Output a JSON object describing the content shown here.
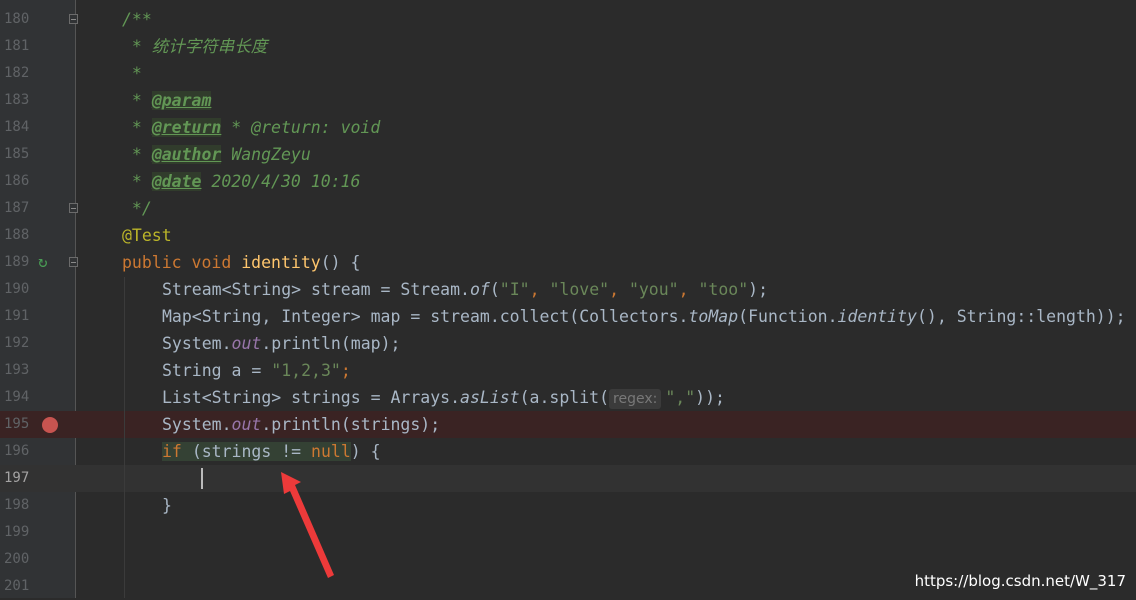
{
  "editor": {
    "lines": [
      {
        "number": "180"
      },
      {
        "number": "181"
      },
      {
        "number": "182"
      },
      {
        "number": "183"
      },
      {
        "number": "184"
      },
      {
        "number": "185"
      },
      {
        "number": "186"
      },
      {
        "number": "187"
      },
      {
        "number": "188"
      },
      {
        "number": "189"
      },
      {
        "number": "190"
      },
      {
        "number": "191"
      },
      {
        "number": "192"
      },
      {
        "number": "193"
      },
      {
        "number": "194"
      },
      {
        "number": "195"
      },
      {
        "number": "196"
      },
      {
        "number": "197"
      },
      {
        "number": "198"
      },
      {
        "number": "199"
      },
      {
        "number": "200"
      },
      {
        "number": "201"
      }
    ],
    "code": {
      "l180": "/**",
      "l181": " * 统计字符串长度",
      "l182": " *",
      "l183_star": " * ",
      "l183_tag": "@param",
      "l184_star": " * ",
      "l184_tag": "@return",
      "l184_rest": " * @return: void",
      "l185_star": " * ",
      "l185_tag": "@author",
      "l185_rest": " WangZeyu",
      "l186_star": " * ",
      "l186_tag": "@date",
      "l186_rest": " 2020/4/30 10:16",
      "l187": " */",
      "l188": "@Test",
      "l189_kw": "public void ",
      "l189_fn": "identity",
      "l189_rest": "() {",
      "l190_a": "Stream<String> stream = Stream.",
      "l190_of": "of",
      "l190_b": "(",
      "l190_s1": "\"I\"",
      "l190_c1": ", ",
      "l190_s2": "\"love\"",
      "l190_c2": ", ",
      "l190_s3": "\"you\"",
      "l190_c3": ", ",
      "l190_s4": "\"too\"",
      "l190_end": ");",
      "l191_a": "Map<String, Integer> map = stream.collect(Collectors.",
      "l191_tomap": "toMap",
      "l191_b": "(Function.",
      "l191_identity": "identity",
      "l191_c": "(), String::length));",
      "l192_a": "System.",
      "l192_out": "out",
      "l192_b": ".println(map);",
      "l193_a": "String a = ",
      "l193_str": "\"1,2,3\"",
      "l193_b": ";",
      "l194_a": "List<String> strings = Arrays.",
      "l194_aslist": "asList",
      "l194_b": "(a.split(",
      "l194_hint": "regex:",
      "l194_str": "\",\"",
      "l194_c": "));",
      "l195_a": "System.",
      "l195_out": "out",
      "l195_b": ".println(strings);",
      "l196_if": "if ",
      "l196_open": "(",
      "l196_var": "strings != ",
      "l196_null": "null",
      "l196_close": ")",
      "l196_brace": " {",
      "l198": "}"
    },
    "gutter_icons": {
      "run": "run-test-icon",
      "breakpoint": "breakpoint-icon",
      "fold": "fold-icon"
    }
  },
  "watermark": "https://blog.csdn.net/W_317",
  "annotation": "red-arrow-icon",
  "colors": {
    "background": "#2b2b2b",
    "gutter": "#313335",
    "keyword": "#cc7832",
    "string": "#6a8759",
    "doc": "#629755",
    "annotation": "#bbb529",
    "method": "#ffc66d",
    "static_field": "#9876aa",
    "breakpoint": "#c75450",
    "arrow": "#ed3a3a"
  }
}
